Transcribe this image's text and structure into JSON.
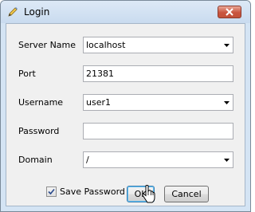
{
  "window": {
    "title": "Login",
    "app_icon": "pencil-icon",
    "close_icon": "close-icon"
  },
  "form": {
    "server_name": {
      "label": "Server Name",
      "value": "localhost"
    },
    "port": {
      "label": "Port",
      "value": "21381"
    },
    "username": {
      "label": "Username",
      "value": "user1"
    },
    "password": {
      "label": "Password",
      "value": ""
    },
    "domain": {
      "label": "Domain",
      "value": "/"
    }
  },
  "footer": {
    "save_password": {
      "label": "Save Password",
      "checked": true
    },
    "ok_label": "OK",
    "cancel_label": "Cancel"
  },
  "colors": {
    "close_button": "#c9553f",
    "default_button_border": "#3c7fb1"
  }
}
